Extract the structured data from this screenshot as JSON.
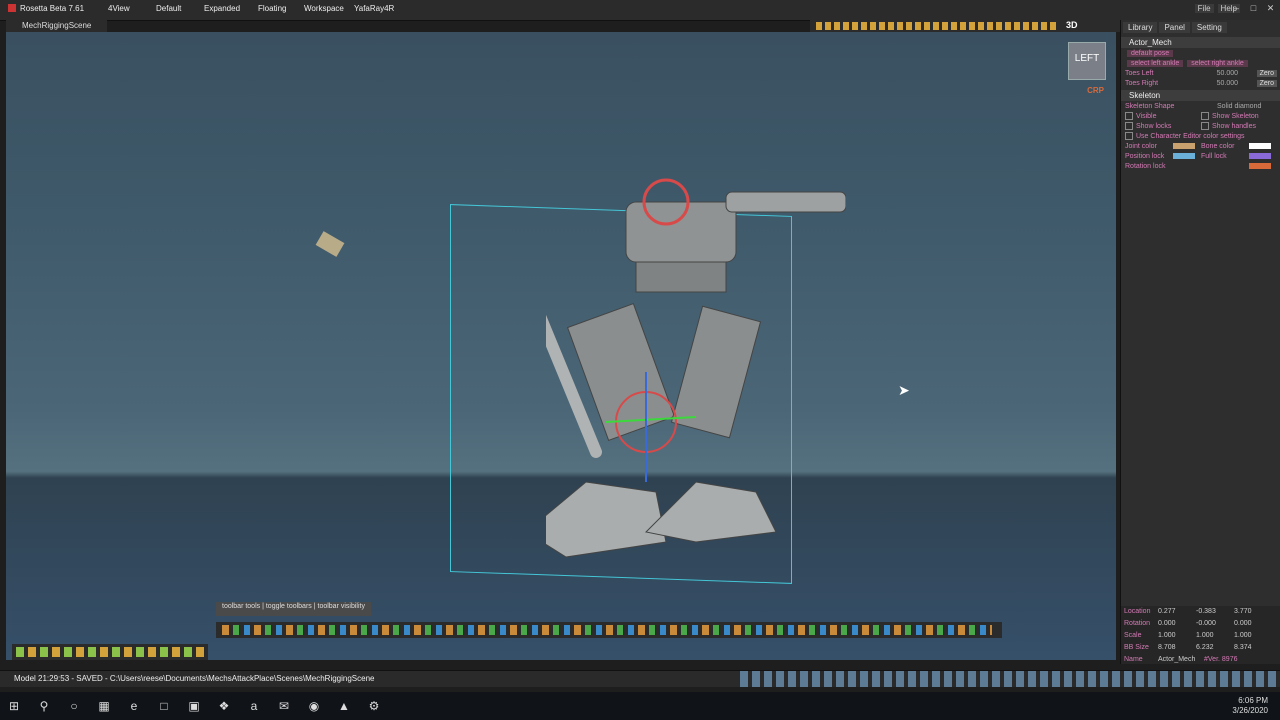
{
  "window": {
    "title": "Rosetta Beta 7.61",
    "menus": [
      "4View",
      "Default",
      "Expanded",
      "Floating",
      "Workspace",
      "YafaRay4R"
    ],
    "right_menu": [
      "File",
      "Help"
    ]
  },
  "viewport": {
    "tab_label": "MechRiggingScene",
    "view_mode": "3D",
    "navcube_label": "LEFT",
    "camera_label": "CRP"
  },
  "side_panel": {
    "tabs": [
      "Library",
      "Panel",
      "Setting"
    ],
    "actor_section": "Actor_Mech",
    "buttons": [
      "default pose",
      "select left ankle",
      "select right ankle"
    ],
    "toes_left_label": "Toes Left",
    "toes_left_value": "50.000",
    "toes_right_label": "Toes Right",
    "toes_right_value": "50.000",
    "zero_label": "Zero",
    "skeleton_section": "Skeleton",
    "skeleton_shape_label": "Skeleton Shape",
    "skeleton_shape_value": "Solid diamond",
    "visible_label": "Visible",
    "show_skeleton_label": "Show Skeleton",
    "show_locks_label": "Show locks",
    "show_handles_label": "Show handles",
    "use_char_color_label": "Use Character Editor color settings",
    "joint_color_label": "Joint color",
    "bone_color_label": "Bone color",
    "position_lock_label": "Position lock",
    "full_lock_label": "Full lock",
    "rotation_lock_label": "Rotation lock",
    "colors": {
      "joint": "#c9a16f",
      "bone": "#ffffff",
      "position_lock": "#6ab0d8",
      "full_lock": "#8a6ad8",
      "rotation_lock": "#d86a3a"
    }
  },
  "properties": {
    "location": {
      "label": "Location",
      "x": "0.277",
      "y": "-0.383",
      "z": "3.770"
    },
    "rotation": {
      "label": "Rotation",
      "x": "0.000",
      "y": "-0.000",
      "z": "0.000"
    },
    "scale": {
      "label": "Scale",
      "x": "1.000",
      "y": "1.000",
      "z": "1.000"
    },
    "bbsize": {
      "label": "BB Size",
      "x": "8.708",
      "y": "6.232",
      "z": "8.374"
    },
    "name": {
      "label": "Name",
      "value": "Actor_Mech",
      "ver": "#Ver. 8976"
    }
  },
  "toolbar_label": {
    "a": "toolbar tools",
    "b": "toggle toolbars",
    "c": "toolbar visibility"
  },
  "status": {
    "mode": "Model",
    "message": "21:29:53 - SAVED - C:\\Users\\reese\\Documents\\MechsAttackPlace\\Scenes\\MechRiggingScene"
  },
  "taskbar": {
    "time": "6:06 PM",
    "date": "3/26/2020"
  }
}
